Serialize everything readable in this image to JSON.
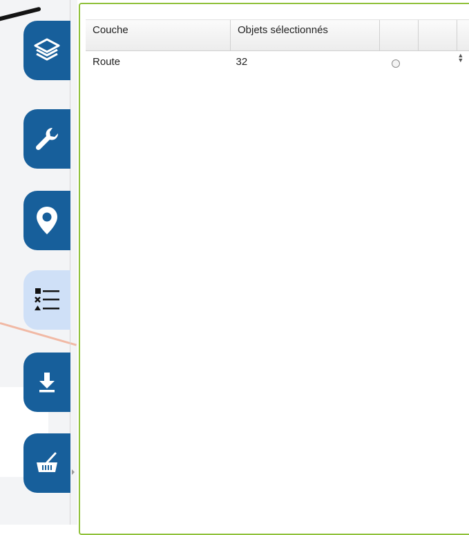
{
  "sidebar": {
    "buttons": [
      {
        "icon": "layers-icon",
        "active": false
      },
      {
        "icon": "wrench-icon",
        "active": false
      },
      {
        "icon": "map-pin-icon",
        "active": false
      },
      {
        "icon": "legend-list-icon",
        "active": true
      },
      {
        "icon": "download-icon",
        "active": false
      },
      {
        "icon": "basket-icon",
        "active": false
      }
    ],
    "colors": {
      "button": "#175f9b",
      "active": "#cfe0f7"
    }
  },
  "selection_table": {
    "columns": [
      "Couche",
      "Objets sélectionnés",
      "",
      "",
      ""
    ],
    "rows": [
      {
        "layer": "Route",
        "count": "32"
      }
    ]
  },
  "colors": {
    "panel_border": "#8fc13a"
  }
}
